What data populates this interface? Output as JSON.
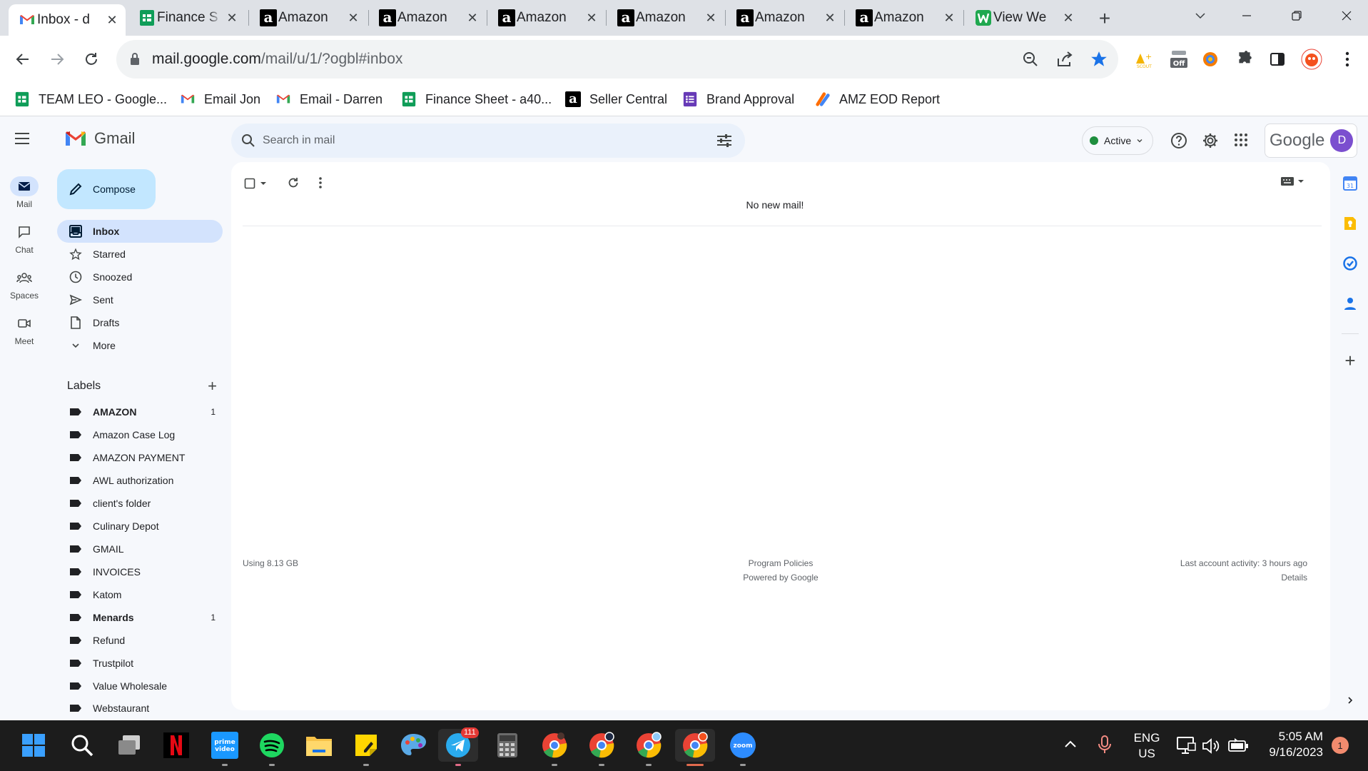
{
  "browser": {
    "tabs": [
      {
        "title": "Inbox - d",
        "icon": "gmail-icon",
        "active": true
      },
      {
        "title": "Finance S",
        "icon": "sheets-icon"
      },
      {
        "title": "Amazon",
        "icon": "amazon-icon"
      },
      {
        "title": "Amazon",
        "icon": "amazon-icon"
      },
      {
        "title": "Amazon",
        "icon": "amazon-icon"
      },
      {
        "title": "Amazon",
        "icon": "amazon-icon"
      },
      {
        "title": "Amazon",
        "icon": "amazon-icon"
      },
      {
        "title": "Amazon",
        "icon": "amazon-icon"
      },
      {
        "title": "View We",
        "icon": "w-icon"
      }
    ],
    "url_host": "mail.google.com",
    "url_path": "/mail/u/1/?ogbl#inbox",
    "bookmarks": [
      {
        "label": "TEAM LEO - Google...",
        "icon": "sheets-icon"
      },
      {
        "label": "Email Jon",
        "icon": "gmail-icon"
      },
      {
        "label": "Email - Darren",
        "icon": "gmail-icon"
      },
      {
        "label": "Finance Sheet - a40...",
        "icon": "sheets-icon"
      },
      {
        "label": "Seller Central",
        "icon": "amazon-icon"
      },
      {
        "label": "Brand Approval",
        "icon": "forms-icon"
      },
      {
        "label": "AMZ EOD Report",
        "icon": "zapier-icon"
      }
    ],
    "extension_badge": "Off"
  },
  "gmail": {
    "app_name": "Gmail",
    "search_placeholder": "Search in mail",
    "status": "Active",
    "google_word": "Google",
    "avatar_letter": "D",
    "rail": [
      {
        "label": "Mail",
        "icon": "mail-icon"
      },
      {
        "label": "Chat",
        "icon": "chat-icon"
      },
      {
        "label": "Spaces",
        "icon": "spaces-icon"
      },
      {
        "label": "Meet",
        "icon": "meet-icon"
      }
    ],
    "compose_label": "Compose",
    "nav": [
      {
        "label": "Inbox",
        "icon": "inbox-icon"
      },
      {
        "label": "Starred",
        "icon": "star-icon"
      },
      {
        "label": "Snoozed",
        "icon": "clock-icon"
      },
      {
        "label": "Sent",
        "icon": "send-icon"
      },
      {
        "label": "Drafts",
        "icon": "draft-icon"
      },
      {
        "label": "More",
        "icon": "chevron-down-icon"
      }
    ],
    "labels_heading": "Labels",
    "labels": [
      {
        "label": "AMAZON",
        "count": "1"
      },
      {
        "label": "Amazon Case Log",
        "count": ""
      },
      {
        "label": "AMAZON PAYMENT",
        "count": ""
      },
      {
        "label": "AWL authorization",
        "count": ""
      },
      {
        "label": "client's folder",
        "count": ""
      },
      {
        "label": "Culinary Depot",
        "count": ""
      },
      {
        "label": "GMAIL",
        "count": ""
      },
      {
        "label": "INVOICES",
        "count": ""
      },
      {
        "label": "Katom",
        "count": ""
      },
      {
        "label": "Menards",
        "count": "1"
      },
      {
        "label": "Refund",
        "count": ""
      },
      {
        "label": "Trustpilot",
        "count": ""
      },
      {
        "label": "Value Wholesale",
        "count": ""
      },
      {
        "label": "Webstaurant",
        "count": ""
      }
    ],
    "empty_message": "No new mail!",
    "footer": {
      "storage": "Using 8.13 GB",
      "policies": "Program Policies",
      "powered": "Powered by Google",
      "last_activity": "Last account activity: 3 hours ago",
      "details": "Details"
    },
    "colors": {
      "accent": "#0b57d0",
      "nav_active": "#d3e3fd",
      "compose": "#c2e7ff",
      "status": "#1e8e3e"
    }
  },
  "taskbar": {
    "apps": [
      "start-icon",
      "search-icon",
      "task-view-icon",
      "netflix-icon",
      "prime-video-icon",
      "spotify-icon",
      "file-explorer-icon",
      "sticky-notes-icon",
      "paint-icon",
      "telegram-icon",
      "calculator-icon",
      "chrome-icon",
      "chrome-icon",
      "chrome-icon",
      "chrome-icon",
      "zoom-icon"
    ],
    "telegram_badge": "111",
    "prime_label": "prime video",
    "zoom_label": "zoom",
    "language": "ENG",
    "region": "US",
    "time": "5:05 AM",
    "date": "9/16/2023",
    "notification_count": "1"
  }
}
